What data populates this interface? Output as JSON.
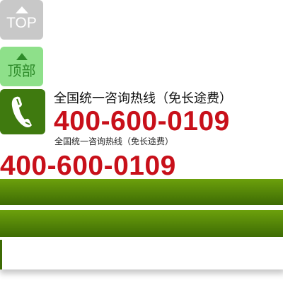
{
  "nav": {
    "top_label": "TOP",
    "cn_top_label": "顶部"
  },
  "contact": {
    "hotline_heading": "全国统一咨询热线（免长途费）",
    "hotline_number": "400-600-0109",
    "hotline_heading_small": "全国统一咨询热线（免长途费）",
    "hotline_number_large": "400-600-0109"
  },
  "icons": {
    "phone": "phone-handset-icon",
    "up_arrow": "up-arrow-icon"
  },
  "colors": {
    "accent_green": "#3f7a0f",
    "hotline_red": "#c8101a",
    "top_button_gray": "#c8c8c8",
    "cn_button_green": "#8ee08a"
  }
}
